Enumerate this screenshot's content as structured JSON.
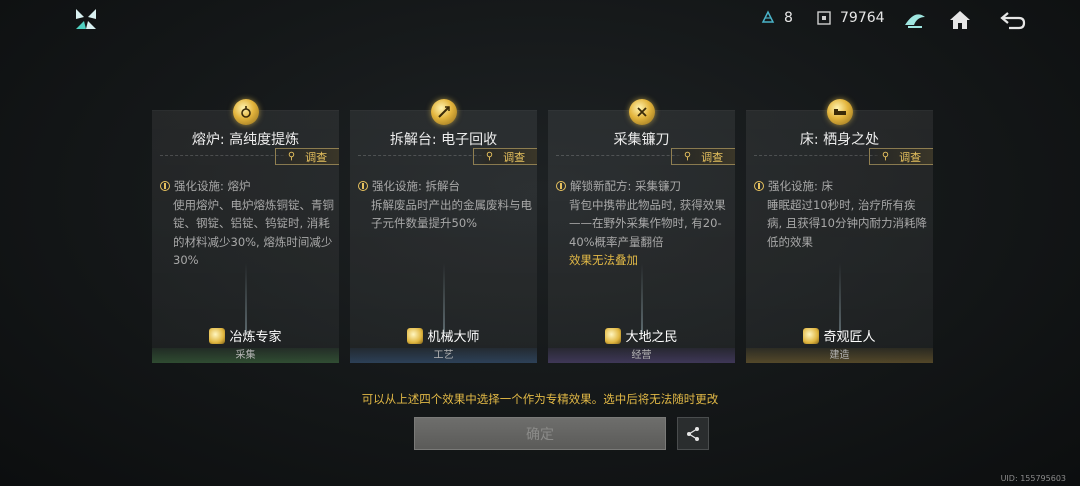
{
  "topbar": {
    "resource1": "8",
    "resource2": "79764"
  },
  "cards": [
    {
      "title": "熔炉: 高纯度提炼",
      "investigate": "调查",
      "head": "强化设施: 熔炉",
      "body": "使用熔炉、电炉熔炼铜锭、青铜锭、钢锭、铝锭、钨锭时, 消耗的材料减少30%, 熔炼时间减少30%",
      "warn": "",
      "badge": "冶炼专家",
      "category": "采集"
    },
    {
      "title": "拆解台: 电子回收",
      "investigate": "调查",
      "head": "强化设施: 拆解台",
      "body": "拆解废品时产出的金属废料与电子元件数量提升50%",
      "warn": "",
      "badge": "机械大师",
      "category": "工艺"
    },
    {
      "title": "采集镰刀",
      "investigate": "调查",
      "head": "解锁新配方: 采集镰刀",
      "body": "背包中携带此物品时, 获得效果——在野外采集作物时, 有20-40%概率产量翻倍",
      "warn": "效果无法叠加",
      "badge": "大地之民",
      "category": "经营"
    },
    {
      "title": "床: 栖身之处",
      "investigate": "调查",
      "head": "强化设施: 床",
      "body": "睡眠超过10秒时, 治疗所有疾病, 且获得10分钟内耐力消耗降低的效果",
      "warn": "",
      "badge": "奇观匠人",
      "category": "建造"
    }
  ],
  "notice": "可以从上述四个效果中选择一个作为专精效果。选中后将无法随时更改",
  "confirm_label": "确定",
  "uid": "UID: 155795603"
}
